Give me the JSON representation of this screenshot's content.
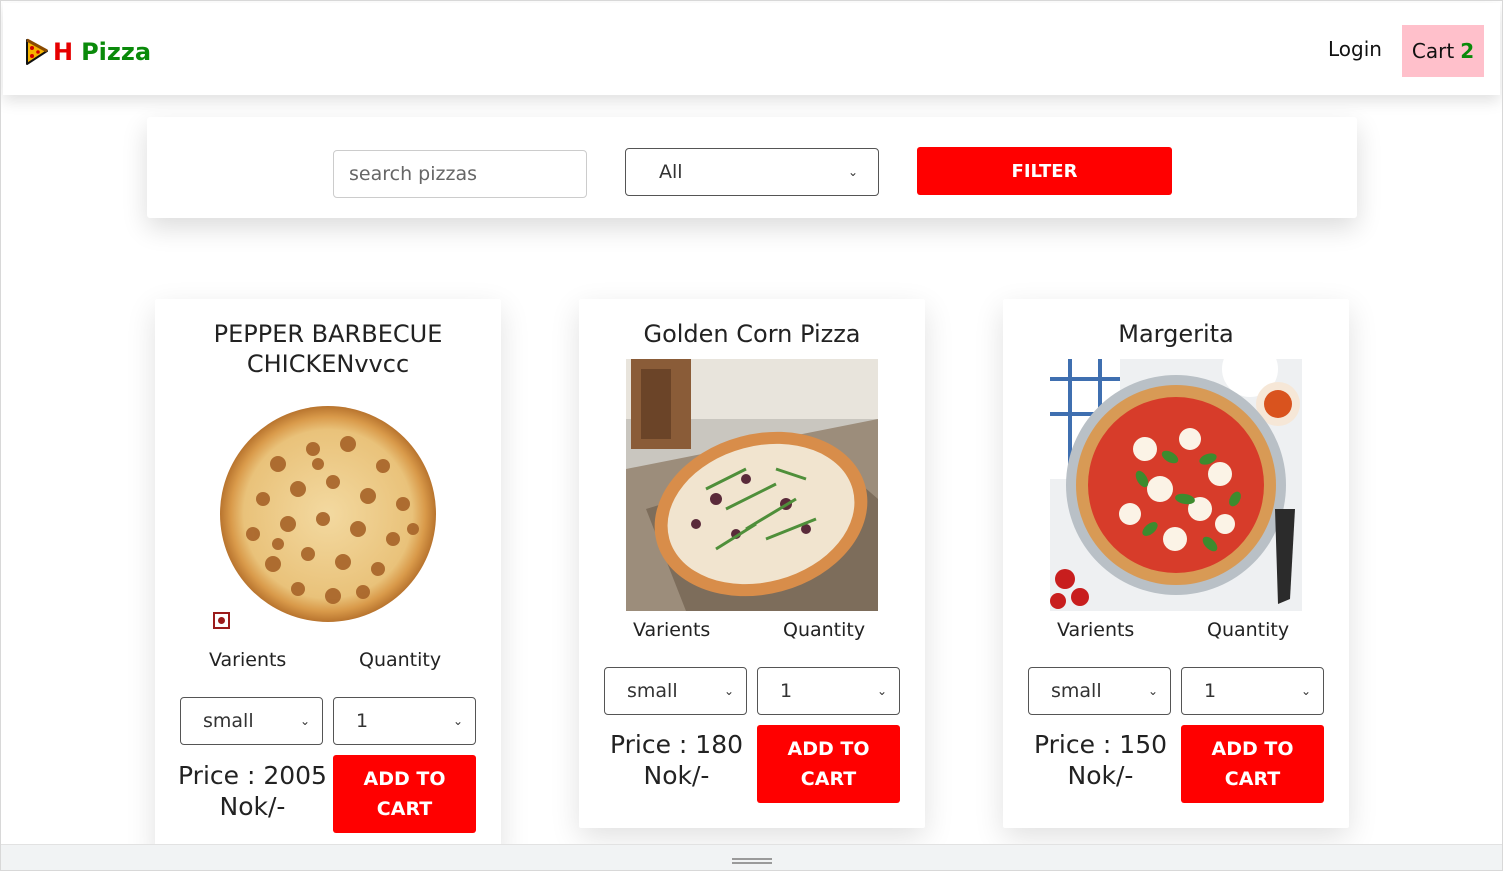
{
  "navbar": {
    "logo_icon": "pizza-slice-icon",
    "brand_first": "H",
    "brand_second": "Pizza",
    "login_label": "Login",
    "cart_label": "Cart",
    "cart_count": "2",
    "cart_bg": "#ffc0cb"
  },
  "filters": {
    "search_placeholder": "search pizzas",
    "category_selected": "All",
    "filter_label": "FILTER",
    "accent": "#ff0000"
  },
  "labels": {
    "variants": "Varients",
    "quantity": "Quantity",
    "add_to_cart": "ADD TO CART"
  },
  "pizzas": [
    {
      "name": "PEPPER BARBECUE CHICKENvvcc",
      "variant": "small",
      "quantity": "1",
      "price": "Price : 2005 Nok/-",
      "veg_indicator": "non-veg-icon"
    },
    {
      "name": "Golden Corn Pizza",
      "variant": "small",
      "quantity": "1",
      "price": "Price : 180 Nok/-"
    },
    {
      "name": "Margerita",
      "variant": "small",
      "quantity": "1",
      "price": "Price : 150 Nok/-"
    }
  ]
}
